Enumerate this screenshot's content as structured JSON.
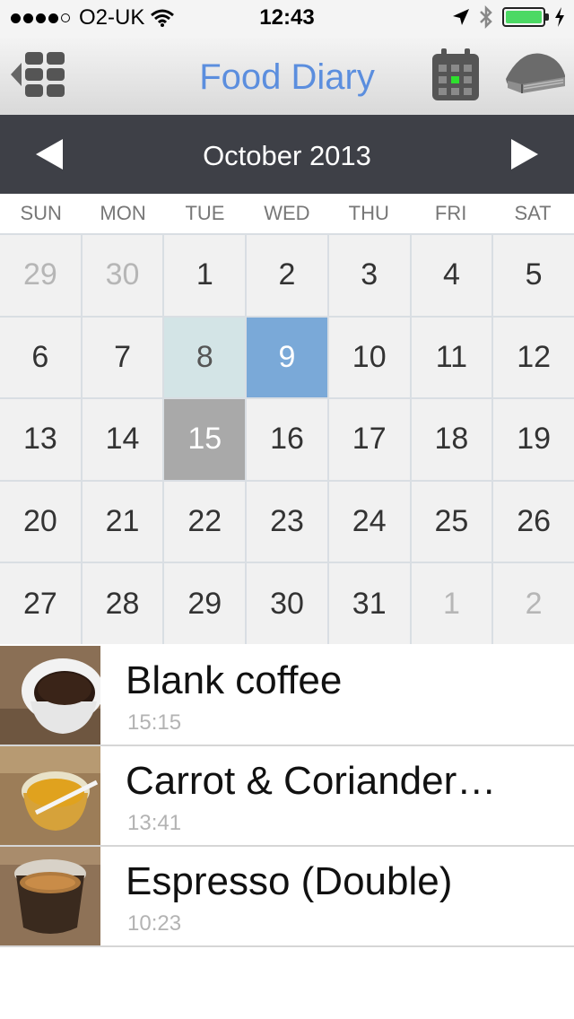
{
  "status_bar": {
    "carrier": "O2-UK",
    "time": "12:43",
    "battery_level": 1.0
  },
  "navbar": {
    "title": "Food Diary",
    "title_color": "#5b8ede",
    "back_icon": "grid-back-icon",
    "calendar_icon": "calendar-icon",
    "book_icon": "book-icon"
  },
  "calendar": {
    "month_label": "October 2013",
    "weekdays": [
      "SUN",
      "MON",
      "TUE",
      "WED",
      "THU",
      "FRI",
      "SAT"
    ],
    "days": [
      {
        "label": "29",
        "state": "muted"
      },
      {
        "label": "30",
        "state": "muted"
      },
      {
        "label": "1",
        "state": ""
      },
      {
        "label": "2",
        "state": ""
      },
      {
        "label": "3",
        "state": ""
      },
      {
        "label": "4",
        "state": ""
      },
      {
        "label": "5",
        "state": ""
      },
      {
        "label": "6",
        "state": ""
      },
      {
        "label": "7",
        "state": ""
      },
      {
        "label": "8",
        "state": "sel-light"
      },
      {
        "label": "9",
        "state": "sel-blue"
      },
      {
        "label": "10",
        "state": ""
      },
      {
        "label": "11",
        "state": ""
      },
      {
        "label": "12",
        "state": ""
      },
      {
        "label": "13",
        "state": ""
      },
      {
        "label": "14",
        "state": ""
      },
      {
        "label": "15",
        "state": "sel-gray"
      },
      {
        "label": "16",
        "state": ""
      },
      {
        "label": "17",
        "state": ""
      },
      {
        "label": "18",
        "state": ""
      },
      {
        "label": "19",
        "state": ""
      },
      {
        "label": "20",
        "state": ""
      },
      {
        "label": "21",
        "state": ""
      },
      {
        "label": "22",
        "state": ""
      },
      {
        "label": "23",
        "state": ""
      },
      {
        "label": "24",
        "state": ""
      },
      {
        "label": "25",
        "state": ""
      },
      {
        "label": "26",
        "state": ""
      },
      {
        "label": "27",
        "state": ""
      },
      {
        "label": "28",
        "state": ""
      },
      {
        "label": "29",
        "state": ""
      },
      {
        "label": "30",
        "state": ""
      },
      {
        "label": "31",
        "state": ""
      },
      {
        "label": "1",
        "state": "muted"
      },
      {
        "label": "2",
        "state": "muted"
      }
    ]
  },
  "entries": [
    {
      "name": "Blank coffee",
      "time": "15:15",
      "thumb": "coffee-cup-photo"
    },
    {
      "name": "Carrot & Coriander…",
      "time": "13:41",
      "thumb": "soup-pot-photo"
    },
    {
      "name": "Espresso (Double)",
      "time": "10:23",
      "thumb": "espresso-glass-photo"
    }
  ]
}
